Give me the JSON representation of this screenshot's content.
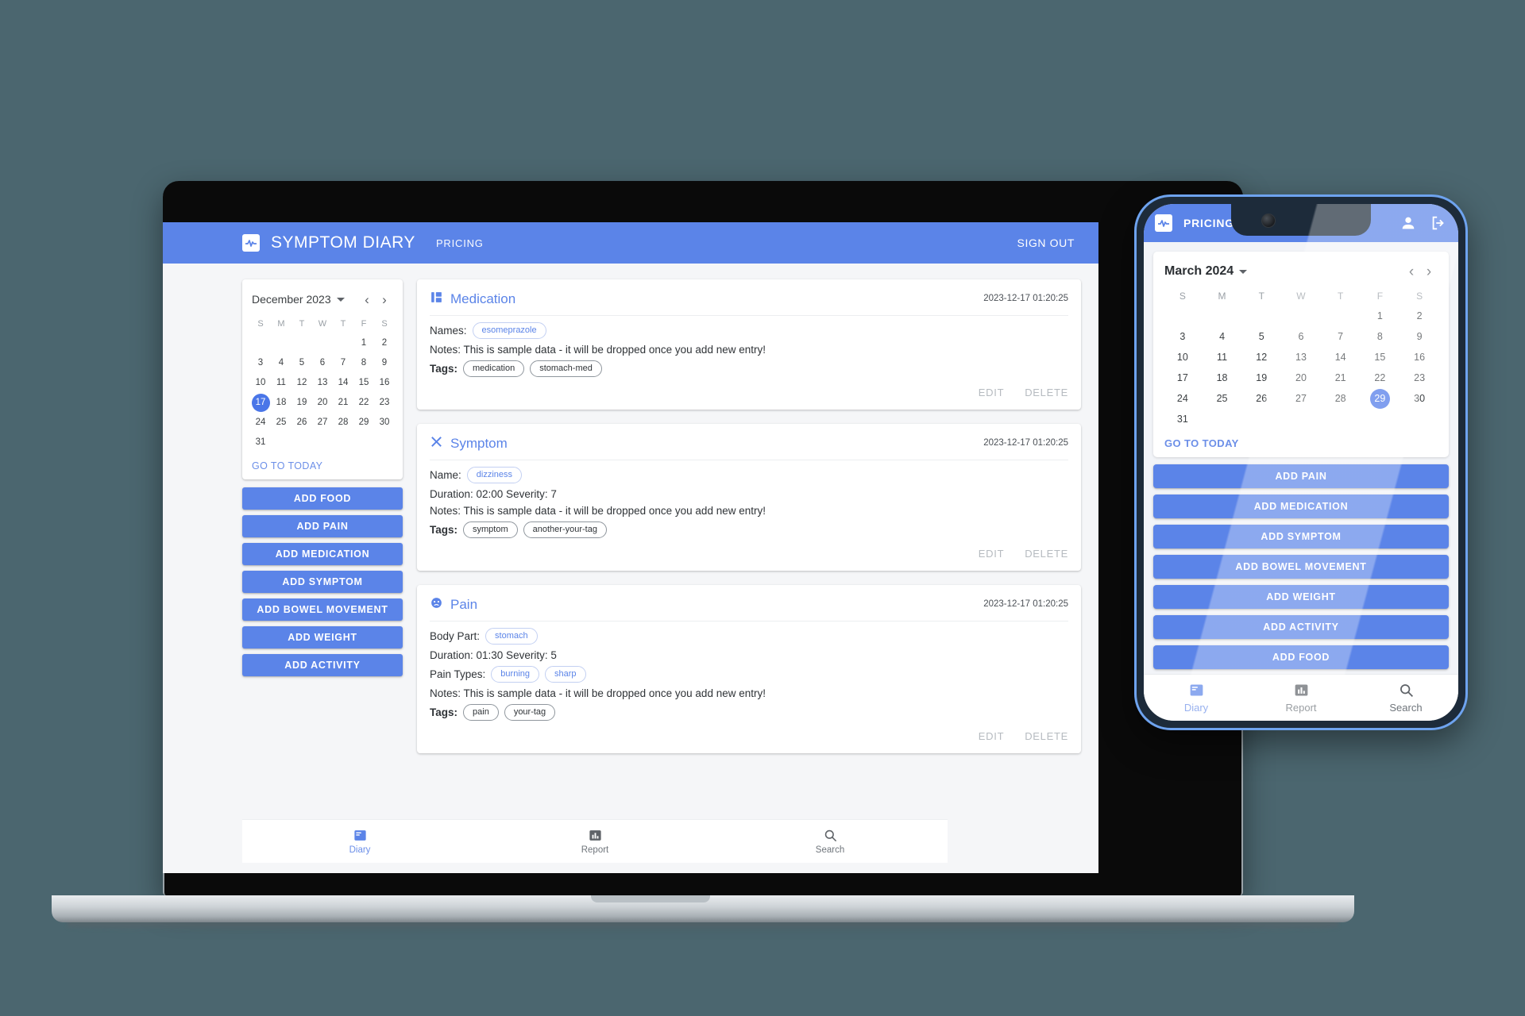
{
  "background_color": "#4b666f",
  "accent_color": "#5b84e8",
  "desktop": {
    "appbar": {
      "logo_icon": "pulse-logo-icon",
      "title": "SYMPTOM DIARY",
      "pricing_label": "PRICING",
      "sign_out_label": "SIGN OUT"
    },
    "calendar": {
      "month_label": "December 2023",
      "caret_icon": "chevron-down-icon",
      "prev_icon": "chevron-left-icon",
      "next_icon": "chevron-right-icon",
      "weekdays": [
        "S",
        "M",
        "T",
        "W",
        "T",
        "F",
        "S"
      ],
      "weeks": [
        [
          "",
          "",
          "",
          "",
          "",
          "1",
          "2"
        ],
        [
          "3",
          "4",
          "5",
          "6",
          "7",
          "8",
          "9"
        ],
        [
          "10",
          "11",
          "12",
          "13",
          "14",
          "15",
          "16"
        ],
        [
          "17",
          "18",
          "19",
          "20",
          "21",
          "22",
          "23"
        ],
        [
          "24",
          "25",
          "26",
          "27",
          "28",
          "29",
          "30"
        ],
        [
          "31",
          "",
          "",
          "",
          "",
          "",
          ""
        ]
      ],
      "selected_day": "17",
      "go_to_today_label": "GO TO TODAY"
    },
    "add_buttons": [
      "ADD FOOD",
      "ADD PAIN",
      "ADD MEDICATION",
      "ADD SYMPTOM",
      "ADD BOWEL MOVEMENT",
      "ADD WEIGHT",
      "ADD ACTIVITY"
    ],
    "entries": [
      {
        "icon": "medication-syringe-icon",
        "title": "Medication",
        "timestamp": "2023-12-17 01:20:25",
        "fields": [
          {
            "kind": "chips",
            "label": "Names:",
            "bold": false,
            "chips": [
              "esomeprazole"
            ],
            "chip_style": "blue"
          }
        ],
        "notes": "Notes: This is sample data - it will be dropped once you add new entry!",
        "tags_label": "Tags",
        "tags": [
          "medication",
          "stomach-med"
        ],
        "edit_label": "EDIT",
        "delete_label": "DELETE"
      },
      {
        "icon": "symptom-bandage-icon",
        "title": "Symptom",
        "timestamp": "2023-12-17 01:20:25",
        "fields": [
          {
            "kind": "chips",
            "label": "Name:",
            "bold": false,
            "chips": [
              "dizziness"
            ],
            "chip_style": "blue"
          },
          {
            "kind": "text",
            "text": "Duration: 02:00   Severity: 7"
          }
        ],
        "notes": "Notes: This is sample data - it will be dropped once you add new entry!",
        "tags_label": "Tags",
        "tags": [
          "symptom",
          "another-your-tag"
        ],
        "edit_label": "EDIT",
        "delete_label": "DELETE"
      },
      {
        "icon": "pain-face-icon",
        "title": "Pain",
        "timestamp": "2023-12-17 01:20:25",
        "fields": [
          {
            "kind": "chips",
            "label": "Body Part:",
            "bold": false,
            "chips": [
              "stomach"
            ],
            "chip_style": "blue"
          },
          {
            "kind": "text",
            "text": "Duration: 01:30   Severity: 5"
          },
          {
            "kind": "chips",
            "label": "Pain Types:",
            "bold": false,
            "chips": [
              "burning",
              "sharp"
            ],
            "chip_style": "blue"
          }
        ],
        "notes": "Notes: This is sample data - it will be dropped once you add new entry!",
        "tags_label": "Tags",
        "tags": [
          "pain",
          "your-tag"
        ],
        "edit_label": "EDIT",
        "delete_label": "DELETE"
      }
    ],
    "bottom_nav": [
      {
        "icon": "diary-book-icon",
        "label": "Diary",
        "active": true
      },
      {
        "icon": "report-bar-chart-icon",
        "label": "Report",
        "active": false
      },
      {
        "icon": "search-magnifier-icon",
        "label": "Search",
        "active": false
      }
    ]
  },
  "phone": {
    "appbar": {
      "logo_icon": "pulse-logo-icon",
      "pricing_label": "PRICING",
      "account_icon": "person-icon",
      "logout_icon": "logout-arrow-icon"
    },
    "calendar": {
      "month_label": "March 2024",
      "caret_icon": "chevron-down-icon",
      "prev_icon": "chevron-left-icon",
      "next_icon": "chevron-right-icon",
      "weekdays": [
        "S",
        "M",
        "T",
        "W",
        "T",
        "F",
        "S"
      ],
      "weeks": [
        [
          "",
          "",
          "",
          "",
          "",
          "1",
          "2"
        ],
        [
          "3",
          "4",
          "5",
          "6",
          "7",
          "8",
          "9"
        ],
        [
          "10",
          "11",
          "12",
          "13",
          "14",
          "15",
          "16"
        ],
        [
          "17",
          "18",
          "19",
          "20",
          "21",
          "22",
          "23"
        ],
        [
          "24",
          "25",
          "26",
          "27",
          "28",
          "29",
          "30"
        ],
        [
          "31",
          "",
          "",
          "",
          "",
          "",
          ""
        ]
      ],
      "selected_day": "29",
      "go_to_today_label": "GO TO TODAY"
    },
    "add_buttons": [
      "ADD PAIN",
      "ADD MEDICATION",
      "ADD SYMPTOM",
      "ADD BOWEL MOVEMENT",
      "ADD WEIGHT",
      "ADD ACTIVITY",
      "ADD FOOD"
    ],
    "bottom_nav": [
      {
        "icon": "diary-book-icon",
        "label": "Diary",
        "active": true
      },
      {
        "icon": "report-bar-chart-icon",
        "label": "Report",
        "active": false
      },
      {
        "icon": "search-magnifier-icon",
        "label": "Search",
        "active": false
      }
    ]
  }
}
